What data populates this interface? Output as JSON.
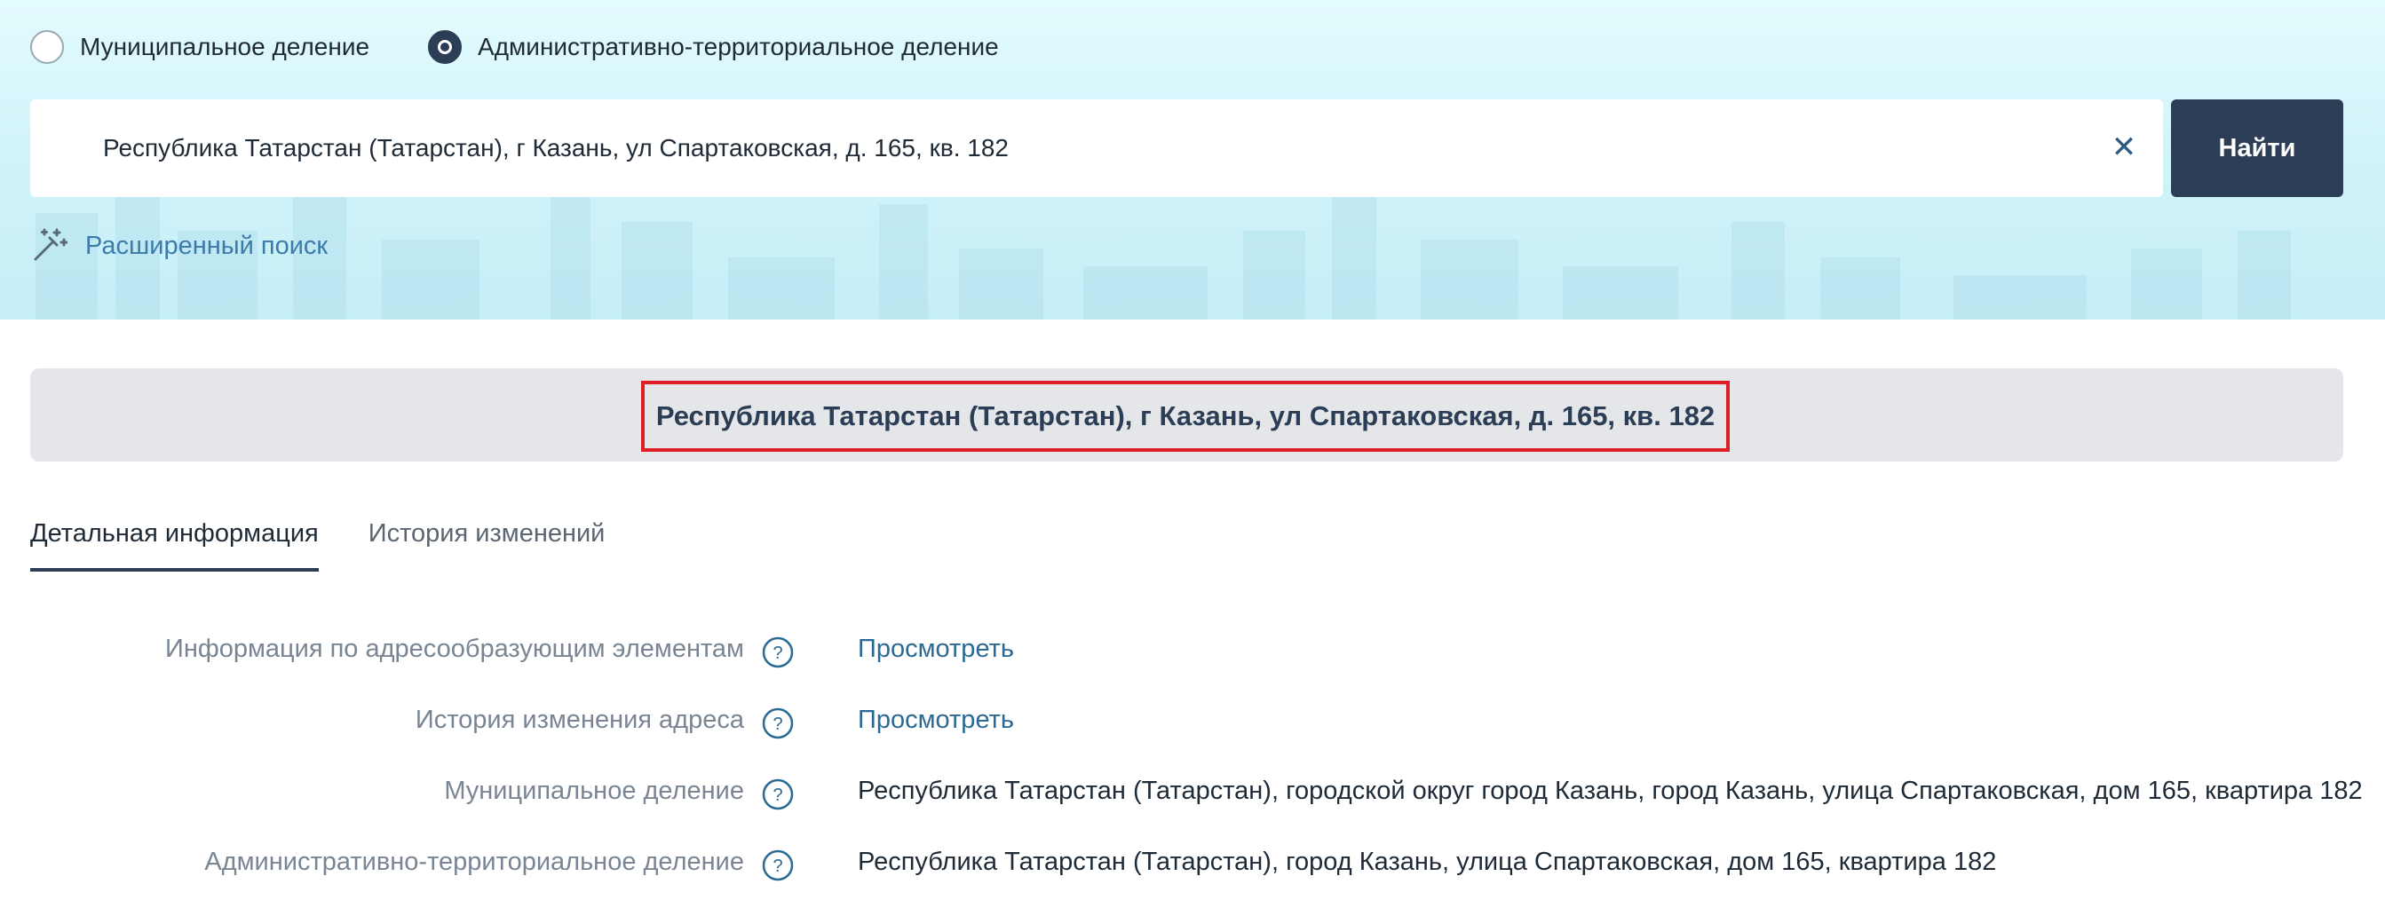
{
  "filter": {
    "options": [
      {
        "label": "Муниципальное деление",
        "checked": false
      },
      {
        "label": "Административно-территориальное деление",
        "checked": true
      }
    ]
  },
  "search": {
    "value": "Республика Татарстан (Татарстан), г Казань, ул Спартаковская, д. 165, кв. 182",
    "clear_icon": "close-icon",
    "button_label": "Найти",
    "advanced_label": "Расширенный поиск",
    "advanced_icon": "magic-wand-icon"
  },
  "result": {
    "title": "Республика Татарстан (Татарстан), г Казань, ул Спартаковская, д. 165, кв. 182"
  },
  "tabs": [
    {
      "label": "Детальная информация",
      "active": true
    },
    {
      "label": "История изменений",
      "active": false
    }
  ],
  "details": [
    {
      "label": "Информация по адресообразующим элементам",
      "value": "Просмотреть",
      "is_link": true
    },
    {
      "label": "История изменения адреса",
      "value": "Просмотреть",
      "is_link": true
    },
    {
      "label": "Муниципальное деление",
      "value": "Республика Татарстан (Татарстан), городской округ город Казань, город Казань, улица Спартаковская, дом 165, квартира 182",
      "is_link": false
    },
    {
      "label": "Административно-территориальное деление",
      "value": "Республика Татарстан (Татарстан), город Казань, улица Спартаковская, дом 165, квартира 182",
      "is_link": false
    }
  ],
  "colors": {
    "primary": "#2c3e55",
    "link": "#2a6a94",
    "highlight_border": "#e01c25",
    "title_band": "#e5e6ea"
  }
}
